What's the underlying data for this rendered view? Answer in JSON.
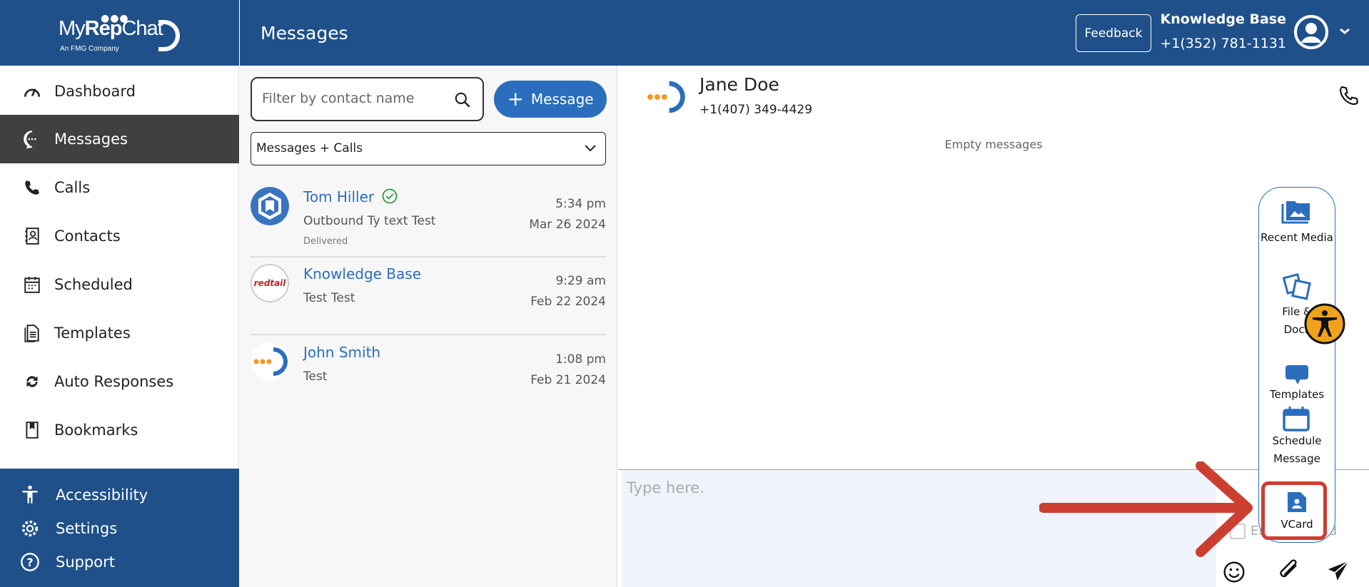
{
  "brand": {
    "name_a": "My",
    "name_b": "Rep",
    "name_c": "Chat",
    "tagline": "An FMG Company"
  },
  "sidebar": {
    "items": [
      {
        "label": "Dashboard",
        "icon": "gauge-icon"
      },
      {
        "label": "Messages",
        "icon": "chat-bubble-icon",
        "active": true
      },
      {
        "label": "Calls",
        "icon": "phone-icon"
      },
      {
        "label": "Contacts",
        "icon": "contact-book-icon"
      },
      {
        "label": "Scheduled",
        "icon": "calendar-icon"
      },
      {
        "label": "Templates",
        "icon": "document-icon"
      },
      {
        "label": "Auto Responses",
        "icon": "refresh-icon"
      },
      {
        "label": "Bookmarks",
        "icon": "bookmark-icon"
      }
    ],
    "bottom": [
      {
        "label": "Accessibility"
      },
      {
        "label": "Settings"
      },
      {
        "label": "Support"
      }
    ]
  },
  "header": {
    "title": "Messages",
    "feedback": "Feedback",
    "user_name": "Knowledge Base",
    "user_phone": "+1(352) 781-1131"
  },
  "list": {
    "search_placeholder": "Filter by contact name",
    "new_message": "Message",
    "filter": "Messages + Calls",
    "conversations": [
      {
        "name": "Tom Hiller",
        "preview": "Outbound Ty text Test",
        "status": "Delivered",
        "time": "5:34 pm",
        "date": "Mar 26 2024",
        "verified": true
      },
      {
        "name": "Knowledge Base",
        "preview": "Test Test",
        "time": "9:29 am",
        "date": "Feb 22 2024"
      },
      {
        "name": "John Smith",
        "preview": "Test",
        "time": "1:08 pm",
        "date": "Feb 21 2024"
      }
    ]
  },
  "chat": {
    "contact_name": "Jane Doe",
    "contact_phone": "+1(407) 349-4429",
    "empty": "Empty messages",
    "input_placeholder": "Type here.",
    "enter_to_send": "Enter to send"
  },
  "tools": [
    {
      "label": "Recent Media"
    },
    {
      "label": "File & Docs"
    },
    {
      "label": "Templates"
    },
    {
      "label": "Schedule Message"
    },
    {
      "label": "VCard"
    }
  ],
  "colors": {
    "brand": "#1f5089",
    "accent": "#2a6ebd",
    "active": "#404040",
    "annotation": "#cc3f30",
    "a11y": "#f0a21c"
  }
}
